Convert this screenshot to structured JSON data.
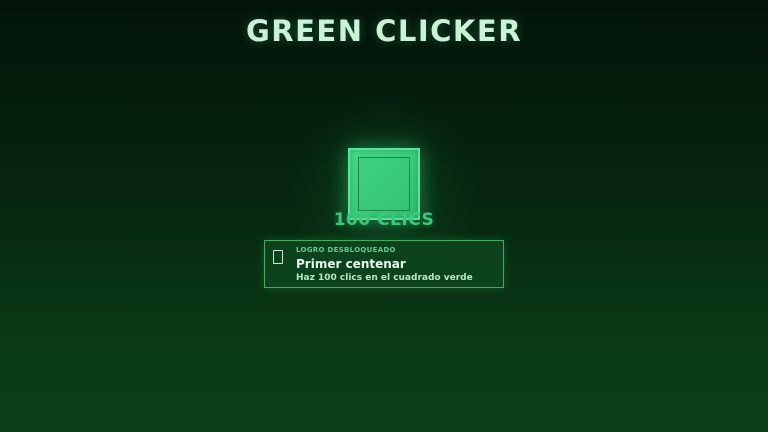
{
  "game": {
    "title": "GREEN CLICKER",
    "click_count_label": "100 CLICS"
  },
  "clicker": {
    "icon": "green-square"
  },
  "achievement": {
    "kicker": "LOGRO DESBLOQUEADO",
    "title": "Primer centenar",
    "description": "Haz 100 clics en el cuadrado verde",
    "icon": "trophy-icon"
  },
  "colors": {
    "background_top": "#03140a",
    "background_bottom": "#0b3f19",
    "square": "#3fd282",
    "accent": "#3ac97b",
    "toast_border": "#3fae63"
  }
}
